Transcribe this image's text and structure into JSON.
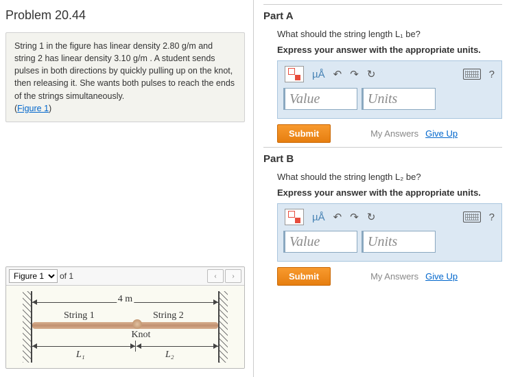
{
  "problem": {
    "title": "Problem 20.44",
    "text_before_link": "String 1 in the figure has linear density 2.80 g/m and string 2 has linear density 3.10 g/m . A student sends pulses in both directions by quickly pulling up on the knot, then releasing it. She wants both pulses to reach the ends of the strings simultaneously.",
    "figure_link_prefix": "(",
    "figure_link": "Figure 1",
    "figure_link_suffix": ")"
  },
  "figure_panel": {
    "selected": "Figure 1",
    "of_text": "of 1",
    "prev": "‹",
    "next": "›",
    "total_label": "4 m",
    "string1_label": "String 1",
    "string2_label": "String 2",
    "knot_label": "Knot",
    "L1_label": "L₁",
    "L2_label": "L₂"
  },
  "part_a": {
    "heading": "Part A",
    "question": "What should the string length L₁ be?",
    "instruction": "Express your answer with the appropriate units.",
    "mu_label": "µÅ",
    "help": "?",
    "value_placeholder": "Value",
    "units_placeholder": "Units",
    "submit": "Submit",
    "my_answers": "My Answers",
    "give_up": "Give Up"
  },
  "part_b": {
    "heading": "Part B",
    "question": "What should the string length L₂ be?",
    "instruction": "Express your answer with the appropriate units.",
    "mu_label": "µÅ",
    "help": "?",
    "value_placeholder": "Value",
    "units_placeholder": "Units",
    "submit": "Submit",
    "my_answers": "My Answers",
    "give_up": "Give Up"
  }
}
